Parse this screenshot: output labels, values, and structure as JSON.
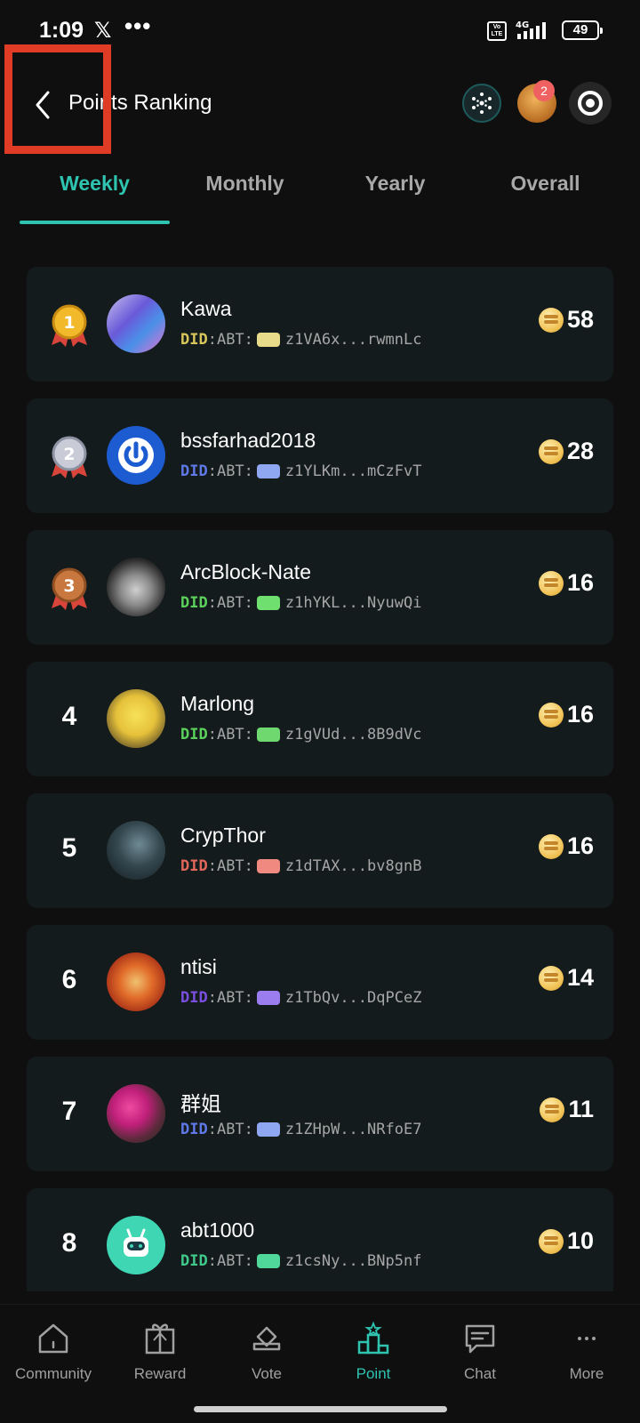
{
  "status_bar": {
    "time": "1:09",
    "x_icon": "x-logo-icon",
    "dots": "•••",
    "volte": "Vo LTE",
    "network": "4G",
    "battery": "49"
  },
  "header": {
    "title": "Points Ranking",
    "notification_count": "2"
  },
  "tabs": [
    {
      "label": "Weekly",
      "active": true
    },
    {
      "label": "Monthly",
      "active": false
    },
    {
      "label": "Yearly",
      "active": false
    },
    {
      "label": "Overall",
      "active": false
    }
  ],
  "rankings": [
    {
      "rank": "1",
      "name": "Kawa",
      "did_prefix": "DID",
      "did_suffix": ":ABT:",
      "address": "z1VA6x...rwmnLc",
      "points": "58",
      "prefix_color": "#d9c65a",
      "chip_color": "#e8dc8a"
    },
    {
      "rank": "2",
      "name": "bssfarhad2018",
      "did_prefix": "DID",
      "did_suffix": ":ABT:",
      "address": "z1YLKm...mCzFvT",
      "points": "28",
      "prefix_color": "#5f79e8",
      "chip_color": "#8fa6f0"
    },
    {
      "rank": "3",
      "name": "ArcBlock-Nate",
      "did_prefix": "DID",
      "did_suffix": ":ABT:",
      "address": "z1hYKL...NyuwQi",
      "points": "16",
      "prefix_color": "#5bd15b",
      "chip_color": "#6fe06f"
    },
    {
      "rank": "4",
      "name": "Marlong",
      "did_prefix": "DID",
      "did_suffix": ":ABT:",
      "address": "z1gVUd...8B9dVc",
      "points": "16",
      "prefix_color": "#5bd15b",
      "chip_color": "#6fd86f"
    },
    {
      "rank": "5",
      "name": "CrypThor",
      "did_prefix": "DID",
      "did_suffix": ":ABT:",
      "address": "z1dTAX...bv8gnB",
      "points": "16",
      "prefix_color": "#e0675a",
      "chip_color": "#f08a80"
    },
    {
      "rank": "6",
      "name": "ntisi",
      "did_prefix": "DID",
      "did_suffix": ":ABT:",
      "address": "z1TbQv...DqPCeZ",
      "points": "14",
      "prefix_color": "#7a4fe0",
      "chip_color": "#9c7df0"
    },
    {
      "rank": "7",
      "name": "群姐",
      "did_prefix": "DID",
      "did_suffix": ":ABT:",
      "address": "z1ZHpW...NRfoE7",
      "points": "11",
      "prefix_color": "#5f79e8",
      "chip_color": "#8fa6f0"
    },
    {
      "rank": "8",
      "name": "abt1000",
      "did_prefix": "DID",
      "did_suffix": ":ABT:",
      "address": "z1csNy...BNp5nf",
      "points": "10",
      "prefix_color": "#3fc98a",
      "chip_color": "#4fd89a"
    }
  ],
  "bottom_nav": [
    {
      "label": "Community",
      "icon": "home-icon",
      "active": false
    },
    {
      "label": "Reward",
      "icon": "gift-icon",
      "active": false
    },
    {
      "label": "Vote",
      "icon": "vote-icon",
      "active": false
    },
    {
      "label": "Point",
      "icon": "podium-icon",
      "active": true
    },
    {
      "label": "Chat",
      "icon": "chat-icon",
      "active": false
    },
    {
      "label": "More",
      "icon": "more-icon",
      "active": false
    }
  ],
  "colors": {
    "accent": "#2ec4b0",
    "card": "#141b1c",
    "background": "#0f0f10",
    "highlight_box": "#e03b24"
  }
}
